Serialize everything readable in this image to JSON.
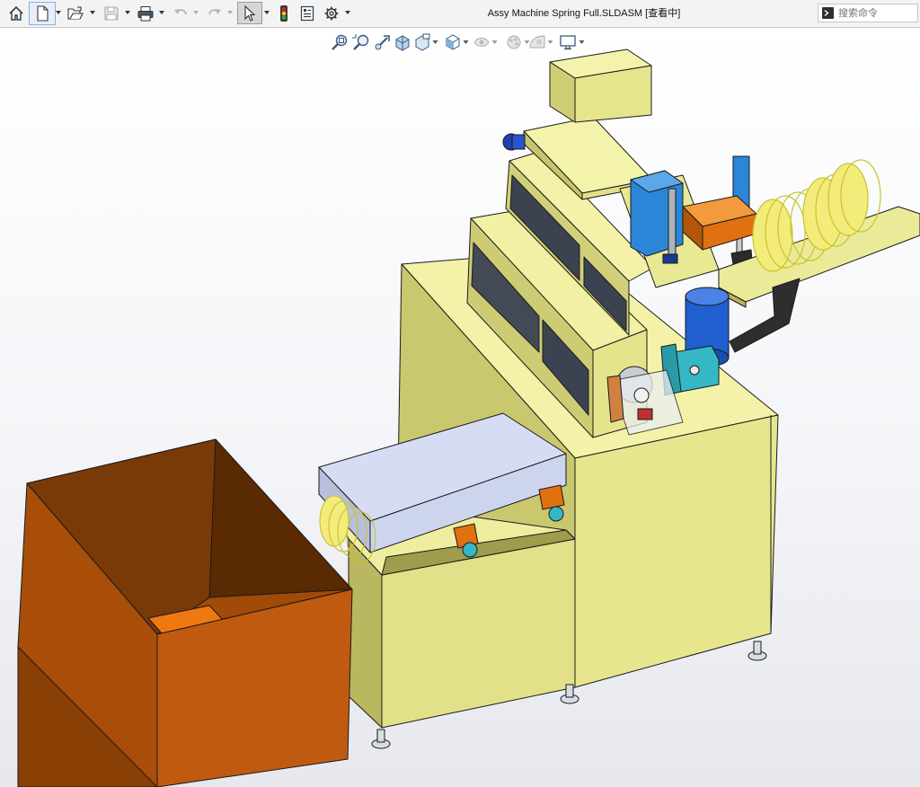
{
  "window": {
    "title": "Assy Machine Spring Full.SLDASM [查看中]"
  },
  "toolbar": {
    "items": [
      {
        "name": "home",
        "icon": "home-icon"
      },
      {
        "name": "new-document",
        "icon": "new-document-icon"
      },
      {
        "name": "open",
        "icon": "open-folder-icon"
      },
      {
        "name": "save",
        "icon": "save-icon"
      },
      {
        "name": "print",
        "icon": "print-icon"
      },
      {
        "name": "undo",
        "icon": "undo-icon"
      },
      {
        "name": "redo",
        "icon": "redo-icon"
      },
      {
        "name": "select",
        "icon": "select-cursor-icon"
      },
      {
        "name": "rebuild",
        "icon": "rebuild-traffic-light-icon"
      },
      {
        "name": "file-properties",
        "icon": "file-properties-icon"
      },
      {
        "name": "options",
        "icon": "gear-icon"
      }
    ]
  },
  "search": {
    "placeholder": "搜索命令"
  },
  "heads_up_toolbar": {
    "items": [
      {
        "name": "zoom-to-fit",
        "icon": "zoom-to-fit-icon"
      },
      {
        "name": "zoom-to-area",
        "icon": "zoom-to-area-icon"
      },
      {
        "name": "previous-view",
        "icon": "previous-view-icon"
      },
      {
        "name": "section-view",
        "icon": "section-view-icon"
      },
      {
        "name": "dynamic-annotation",
        "icon": "dynamic-annotation-icon"
      },
      {
        "name": "view-orientation",
        "icon": "view-orientation-cube-icon"
      },
      {
        "name": "display-style",
        "icon": "display-style-icon"
      },
      {
        "name": "hide-show-items",
        "icon": "hide-show-eye-icon"
      },
      {
        "name": "edit-appearance",
        "icon": "edit-appearance-icon"
      },
      {
        "name": "apply-scene",
        "icon": "apply-scene-icon"
      },
      {
        "name": "view-settings",
        "icon": "monitor-icon"
      }
    ]
  },
  "colors": {
    "frame": "#e7e68f",
    "frame_dark": "#bcbb63",
    "bin": "#a84e08",
    "bin_dark": "#5a2a03",
    "bin_floor": "#f07810",
    "spring": "#f0e86a",
    "motor": "#1f5fd0",
    "cylinder": "#2b86d8",
    "orange": "#e07010",
    "teal": "#36b7c6",
    "chute": "#cdd4ee"
  }
}
